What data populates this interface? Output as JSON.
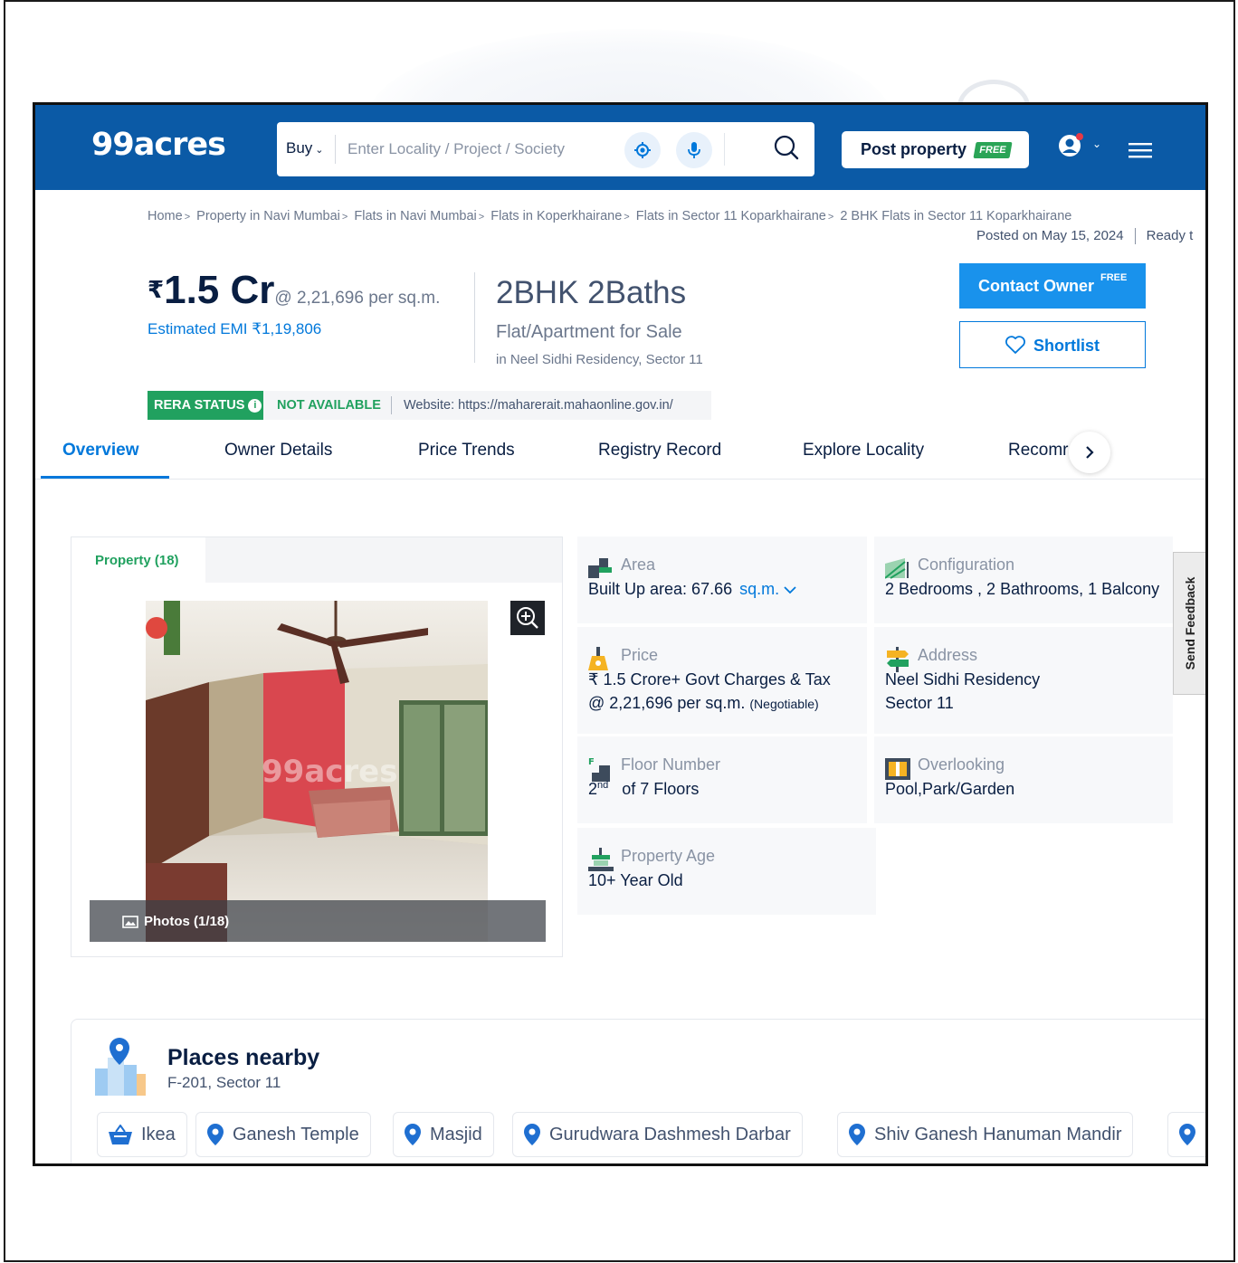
{
  "header": {
    "logo": "99acres",
    "search": {
      "buy_label": "Buy",
      "placeholder": "Enter Locality / Project / Society"
    },
    "post_property": "Post property",
    "post_free_tag": "FREE"
  },
  "breadcrumb": [
    "Home",
    "Property in Navi Mumbai",
    "Flats in Navi Mumbai",
    "Flats in Koperkhairane",
    "Flats in Sector 11 Koparkhairane",
    "2 BHK Flats in Sector 11 Koparkhairane"
  ],
  "posted": {
    "date": "Posted on May 15, 2024",
    "status": "Ready t"
  },
  "price": {
    "currency": "₹",
    "amount": "1.5 Cr",
    "per_sqm": "@ 2,21,696 per sq.m.",
    "emi": "Estimated EMI ₹1,19,806"
  },
  "listing": {
    "config": "2BHK 2Baths",
    "type": "Flat/Apartment for Sale",
    "location": "in Neel Sidhi Residency, Sector 11"
  },
  "actions": {
    "contact_owner": "Contact Owner",
    "contact_free": "FREE",
    "shortlist": "Shortlist"
  },
  "rera": {
    "status_label": "RERA STATUS",
    "status_value": "NOT AVAILABLE",
    "website": "Website: https://maharerait.mahaonline.gov.in/"
  },
  "tabs": [
    {
      "label": "Overview",
      "active": true
    },
    {
      "label": "Owner Details"
    },
    {
      "label": "Price Trends"
    },
    {
      "label": "Registry Record"
    },
    {
      "label": "Explore Locality"
    },
    {
      "label": "Recomr"
    }
  ],
  "gallery": {
    "tab": "Property (18)",
    "watermark": "99acres",
    "photos_label": "Photos (1/18)"
  },
  "features": {
    "area": {
      "label": "Area",
      "value": "Built Up area: 67.66",
      "unit": "sq.m."
    },
    "configuration": {
      "label": "Configuration",
      "value": "2 Bedrooms , 2 Bathrooms, 1 Balcony"
    },
    "price": {
      "label": "Price",
      "value": "₹ 1.5 Crore+ Govt Charges & Tax",
      "value2": "@ 2,21,696 per sq.m.",
      "note": "(Negotiable)"
    },
    "address": {
      "label": "Address",
      "value": "Neel Sidhi Residency",
      "value2": "Sector 11"
    },
    "floor": {
      "label": "Floor Number",
      "floor": "2",
      "suffix": "nd",
      "of": "of 7 Floors"
    },
    "overlooking": {
      "label": "Overlooking",
      "value": "Pool,Park/Garden"
    },
    "age": {
      "label": "Property Age",
      "value": "10+ Year Old"
    }
  },
  "feedback": "Send Feedback",
  "places": {
    "title": "Places nearby",
    "address": "F-201, Sector 11",
    "chips": [
      "Ikea",
      "Ganesh Temple",
      "Masjid",
      "Gurudwara Dashmesh Darbar",
      "Shiv Ganesh Hanuman Mandir"
    ]
  },
  "colors": {
    "brand_blue": "#0b5aa6",
    "link_blue": "#0078db",
    "button_blue": "#1992ec",
    "rera_green": "#21a15f"
  }
}
